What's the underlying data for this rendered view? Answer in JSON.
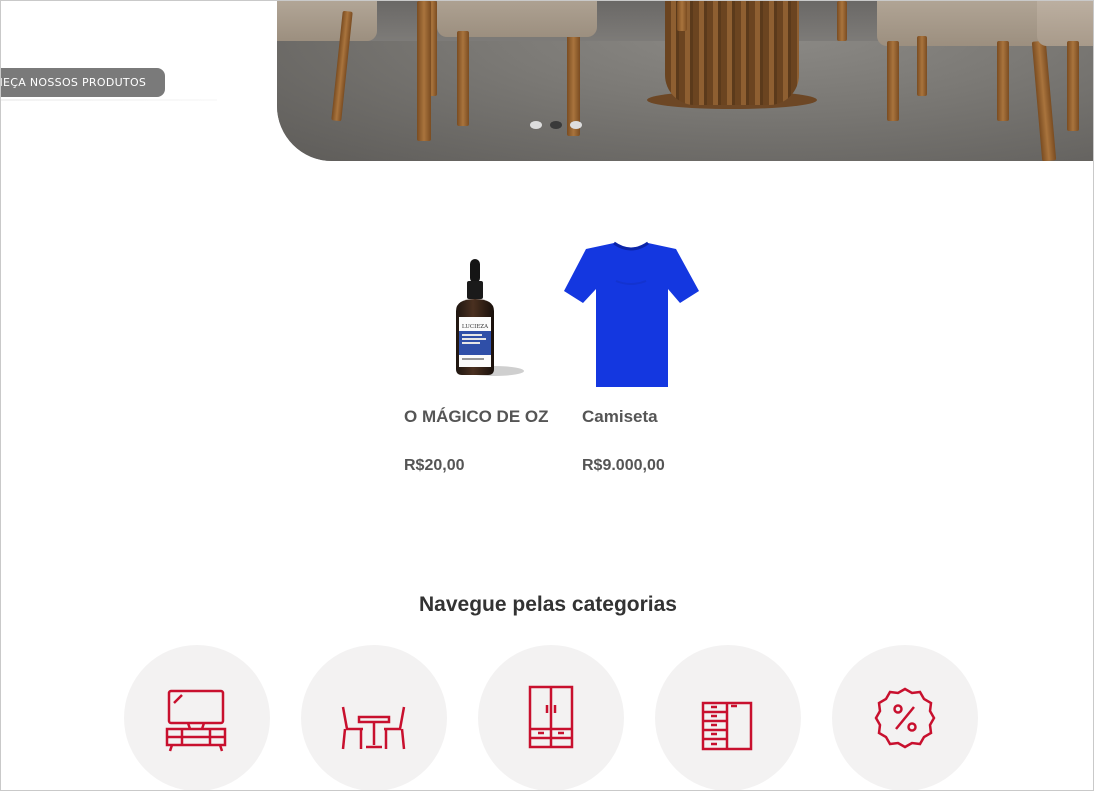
{
  "hero": {
    "cta_label": "CONHEÇA NOSSOS PRODUTOS",
    "slides_count": 3,
    "active_slide": 2
  },
  "products": [
    {
      "name": "O MÁGICO DE OZ",
      "price": "R$20,00",
      "image": "serum-bottle",
      "bottle_brand": "LUCIEZA"
    },
    {
      "name": "Camiseta",
      "price": "R$9.000,00",
      "image": "blue-tshirt"
    }
  ],
  "categories_section": {
    "title": "Navegue pelas categorias",
    "items": [
      {
        "icon": "tv-stand-icon"
      },
      {
        "icon": "dining-table-icon"
      },
      {
        "icon": "wardrobe-icon"
      },
      {
        "icon": "dresser-icon"
      },
      {
        "icon": "discount-badge-icon"
      }
    ]
  },
  "colors": {
    "accent": "#c8102e",
    "cta_bg": "#7a7a7a",
    "category_bg": "#f3f2f2",
    "tshirt": "#1437e0"
  }
}
